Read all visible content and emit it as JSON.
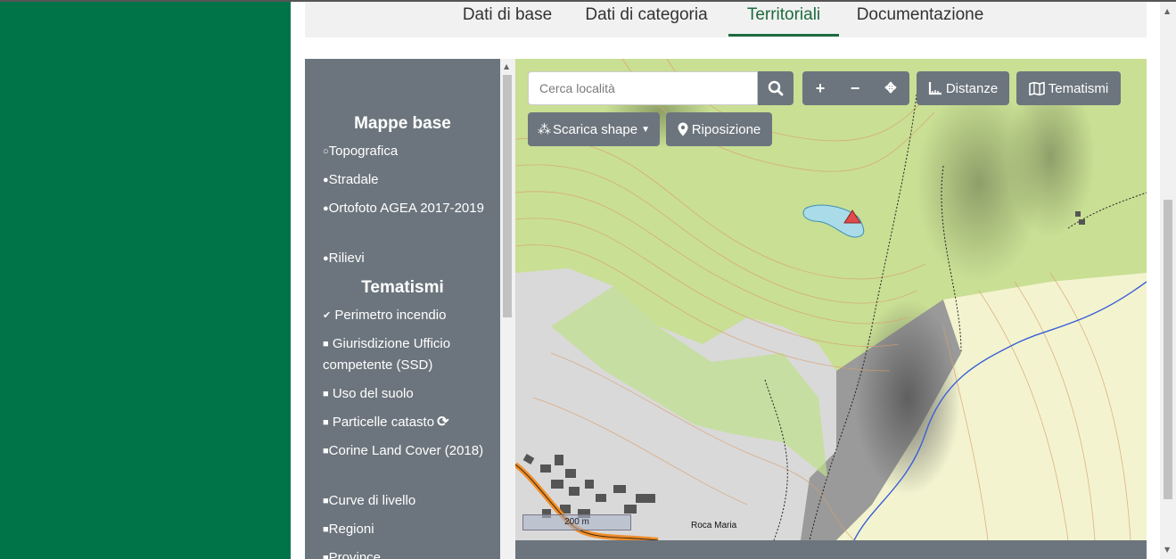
{
  "tabs": {
    "base": "Dati di base",
    "category": "Dati di categoria",
    "territorial": "Territoriali",
    "documentation": "Documentazione"
  },
  "sidebar": {
    "base_maps_title": "Mappe base",
    "base_maps": [
      {
        "label": "Topografica",
        "selected": true
      },
      {
        "label": "Stradale",
        "selected": false
      },
      {
        "label": "Ortofoto AGEA 2017-2019",
        "selected": false
      },
      {
        "label": "Rilievi",
        "selected": false
      }
    ],
    "themes_title": "Tematismi",
    "themes": [
      {
        "label": "Perimetro incendio",
        "checked": true
      },
      {
        "label": "Giurisdizione Ufficio competente (SSD)",
        "checked": false
      },
      {
        "label": "Uso del suolo",
        "checked": false
      },
      {
        "label": "Particelle catasto",
        "checked": false
      },
      {
        "label": "Corine Land Cover (2018)",
        "checked": false
      },
      {
        "label": "Curve di livello",
        "checked": false
      },
      {
        "label": "Regioni",
        "checked": false
      },
      {
        "label": "Province",
        "checked": false
      }
    ]
  },
  "map": {
    "search_placeholder": "Cerca località",
    "distance_label": "Distanze",
    "themes_label": "Tematismi",
    "download_label": "Scarica shape",
    "reposition_label": "Riposizione",
    "scale_label": "200 m",
    "place_label": "Roca Maria"
  },
  "colors": {
    "sidebar_green": "#007449",
    "accent_green": "#1d6b3f",
    "panel_gray": "#6c757d"
  }
}
